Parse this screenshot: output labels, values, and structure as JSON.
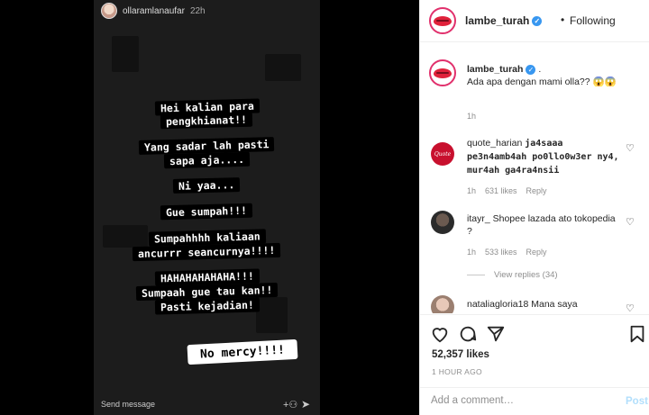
{
  "story": {
    "username": "ollaramlanaufar",
    "time": "22h",
    "lines": [
      "Hei kalian para",
      "pengkhianat!!",
      "Yang sadar lah pasti",
      "sapa aja....",
      "Ni yaa...",
      "Gue sumpah!!!",
      "Sumpahhhh kaliaan",
      "ancurrr seancurnya!!!!",
      "HAHAHAHAHAHA!!!",
      "Sumpaah gue tau kan!!",
      "Pasti kejadian!"
    ],
    "sticker": "No mercy!!!!",
    "send_message": "Send message"
  },
  "post": {
    "header": {
      "username": "lambe_turah",
      "dot": "•",
      "following": "Following"
    },
    "caption": {
      "username": "lambe_turah",
      "suffix": ".",
      "text": "Ada apa dengan mami olla?? 😱😱",
      "time": "1h"
    },
    "comments": [
      {
        "username": "quote_harian",
        "text": "ja4saaa pe3n4amb4ah po0llo0w3er ny4, mur4ah ga4ra4nsii",
        "time": "1h",
        "likes": "631 likes",
        "reply": "Reply"
      },
      {
        "username": "itayr_",
        "text": "Shopee lazada ato tokopedia ?",
        "time": "1h",
        "likes": "533 likes",
        "reply": "Reply"
      },
      {
        "username": "nataliagloria18",
        "text": "Mana saya",
        "time": "",
        "likes": "",
        "reply": ""
      }
    ],
    "view_replies": "View replies (34)",
    "likes": "52,357 likes",
    "time_ago": "1 HOUR AGO",
    "comment_placeholder": "Add a comment…",
    "post_label": "Post"
  },
  "colors": {
    "verified": "#3897f0",
    "lips": "#e0223b",
    "post_button": "#b2dffc",
    "muted": "#8e8e8e"
  }
}
